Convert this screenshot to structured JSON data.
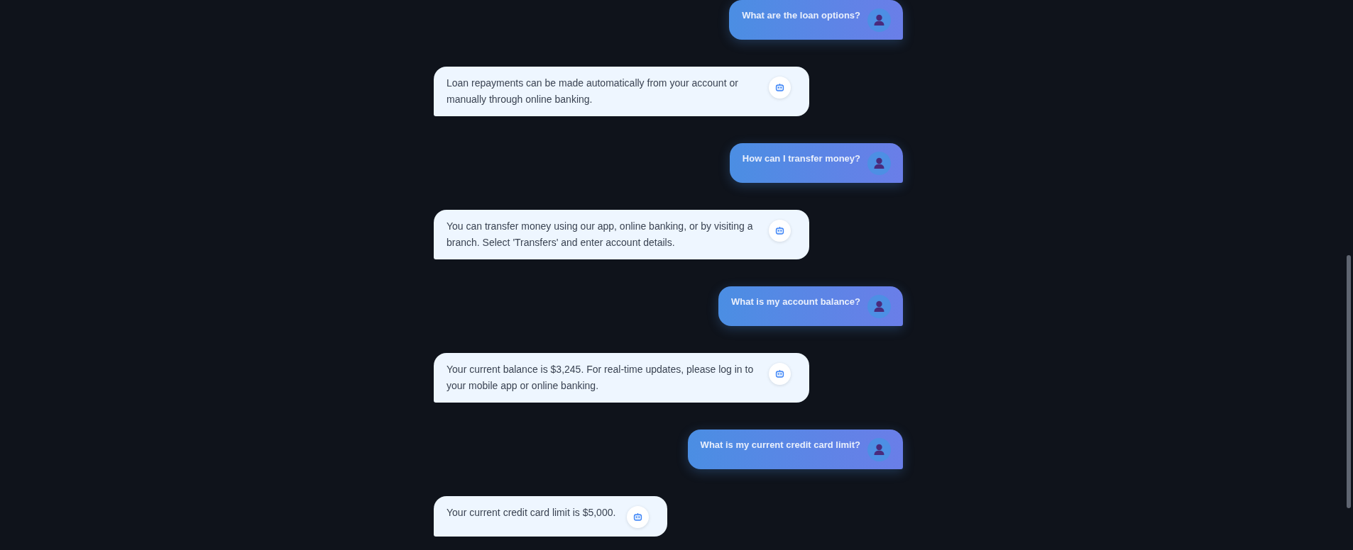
{
  "messages": [
    {
      "kind": "user",
      "text": "What are the loan options?"
    },
    {
      "kind": "bot",
      "text": "Loan repayments can be made automatically from your account or manually through online banking."
    },
    {
      "kind": "user",
      "text": "How can I transfer money?"
    },
    {
      "kind": "bot",
      "text": "You can transfer money using our app, online banking, or by visiting a branch. Select 'Transfers' and enter account details."
    },
    {
      "kind": "user",
      "text": "What is my account balance?"
    },
    {
      "kind": "bot",
      "text": "Your current balance is $3,245. For real-time updates, please log in to your mobile app or online banking."
    },
    {
      "kind": "user",
      "text": "What is my current credit card limit?"
    },
    {
      "kind": "bot",
      "text": "Your current credit card limit is $5,000."
    }
  ]
}
